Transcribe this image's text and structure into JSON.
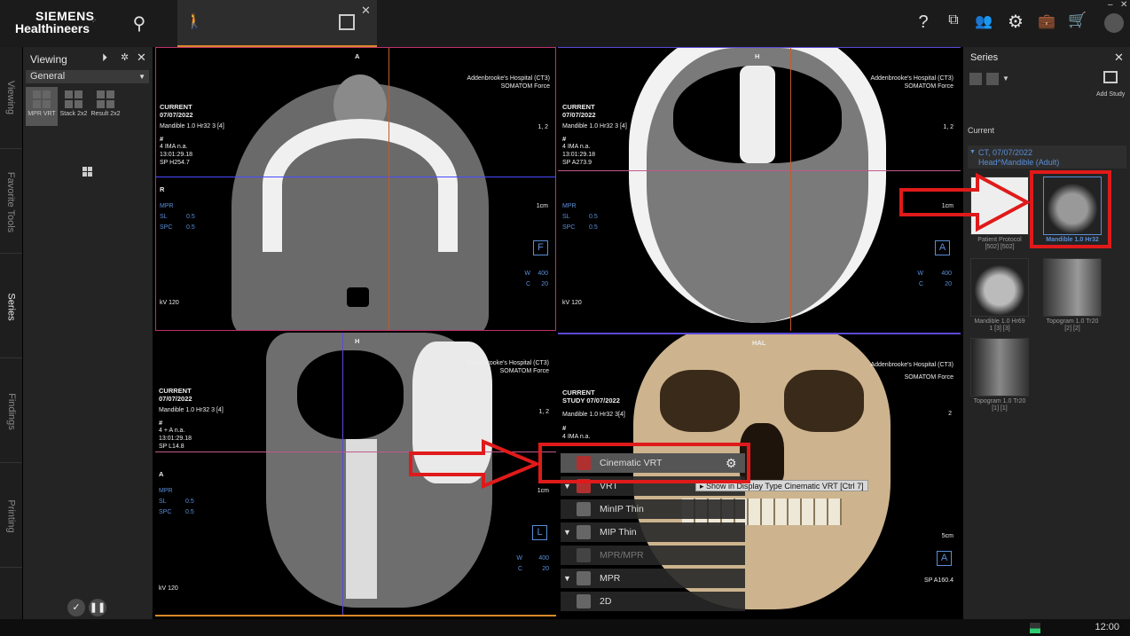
{
  "app": {
    "brand_line1": "SIEMENS",
    "brand_line2": "Healthineers",
    "clock": "12:00"
  },
  "viewing_panel": {
    "title": "Viewing",
    "dropdown_value": "General",
    "layouts": [
      "MPR VRT",
      "Stack 2x2",
      "Result 2x2"
    ]
  },
  "rail_tabs": [
    "Viewing",
    "Favorite Tools",
    "Series",
    "Findings",
    "Printing"
  ],
  "viewports": [
    {
      "orientation_top": "A",
      "hospital": "Addenbrooke's Hospital (CT3)",
      "scanner": "SOMATOM Force",
      "status": "CURRENT",
      "date": "07/07/2022",
      "series": "Mandible  1.0  Hr32  3 [4]",
      "hash": "#",
      "ima": "4 IMA n.a.",
      "time": "13:01:29.18",
      "position": "SP H254.7",
      "side": "R",
      "mpr": "MPR",
      "sl": "SL",
      "sl_val": "0.5",
      "spc": "SPC",
      "spc_val": "0.5",
      "kv": "kV 120",
      "ratio": "1, 2",
      "scale": "1cm",
      "w": "W",
      "w_val": "400",
      "c": "C",
      "c_val": "20",
      "orient_box": "F"
    },
    {
      "orientation_top": "H",
      "hospital": "Addenbrooke's Hospital (CT3)",
      "scanner": "SOMATOM Force",
      "status": "CURRENT",
      "date": "07/07/2022",
      "series": "Mandible  1.0  Hr32  3 [4]",
      "hash": "#",
      "ima": "4 IMA n.a.",
      "time": "13:01:29.18",
      "position": "SP A273.9",
      "side": "",
      "mpr": "MPR",
      "sl": "SL",
      "sl_val": "0.5",
      "spc": "SPC",
      "spc_val": "0.5",
      "kv": "kV 120",
      "ratio": "1, 2",
      "scale": "1cm",
      "w": "W",
      "w_val": "400",
      "c": "C",
      "c_val": "20",
      "orient_box": "A"
    },
    {
      "orientation_top": "H",
      "hospital": "Addenbrooke's Hospital (CT3)",
      "scanner": "SOMATOM Force",
      "status": "CURRENT",
      "date": "07/07/2022",
      "series": "Mandible  1.0  Hr32  3 [4]",
      "hash": "#",
      "ima": "4  + A n.a.",
      "time": "13:01:29.18",
      "position": "SP L14.8",
      "side": "A",
      "mpr": "MPR",
      "sl": "SL",
      "sl_val": "0.5",
      "spc": "SPC",
      "spc_val": "0.5",
      "kv": "kV 120",
      "ratio": "1, 2",
      "scale": "1cm",
      "w": "W",
      "w_val": "400",
      "c": "C",
      "c_val": "20",
      "orient_box": "L"
    },
    {
      "orientation_top": "HAL",
      "hospital": "Addenbrooke's Hospital (CT3)",
      "scanner": "SOMATOM Force",
      "status": "CURRENT",
      "date": "STUDY 07/07/2022",
      "series": "Mandible  1.0  Hr32  3[4]",
      "hash": "#",
      "ima": "4 IMA n.a.",
      "ratio": "2",
      "scale": "5cm",
      "position": "SP A160.4",
      "orient_box": "A"
    }
  ],
  "render_menu": {
    "items": [
      "Cinematic VRT",
      "VRT",
      "MinIP Thin",
      "MIP Thin",
      "MPR/MPR",
      "MPR",
      "2D"
    ],
    "tooltip": "Show in Display Type Cinematic VRT [Ctrl 7]"
  },
  "series_panel": {
    "title": "Series",
    "add_study": "Add Study",
    "current_label": "Current",
    "study_line1": "CT, 07/07/2022",
    "study_line2": "Head^Mandible (Adult)",
    "thumbs": [
      {
        "label1": "Patient Protocol",
        "label2": "[502] [502]"
      },
      {
        "label1": "Mandible  1.0  Hr32",
        "label2": ""
      },
      {
        "label1": "Mandible  1.0  Hr69",
        "label2": "1 [3] [3]"
      },
      {
        "label1": "Topogram  1.0  Tr20",
        "label2": "[2] [2]"
      },
      {
        "label1": "Topogram  1.0  Tr20",
        "label2": "[1] [1]"
      }
    ]
  }
}
